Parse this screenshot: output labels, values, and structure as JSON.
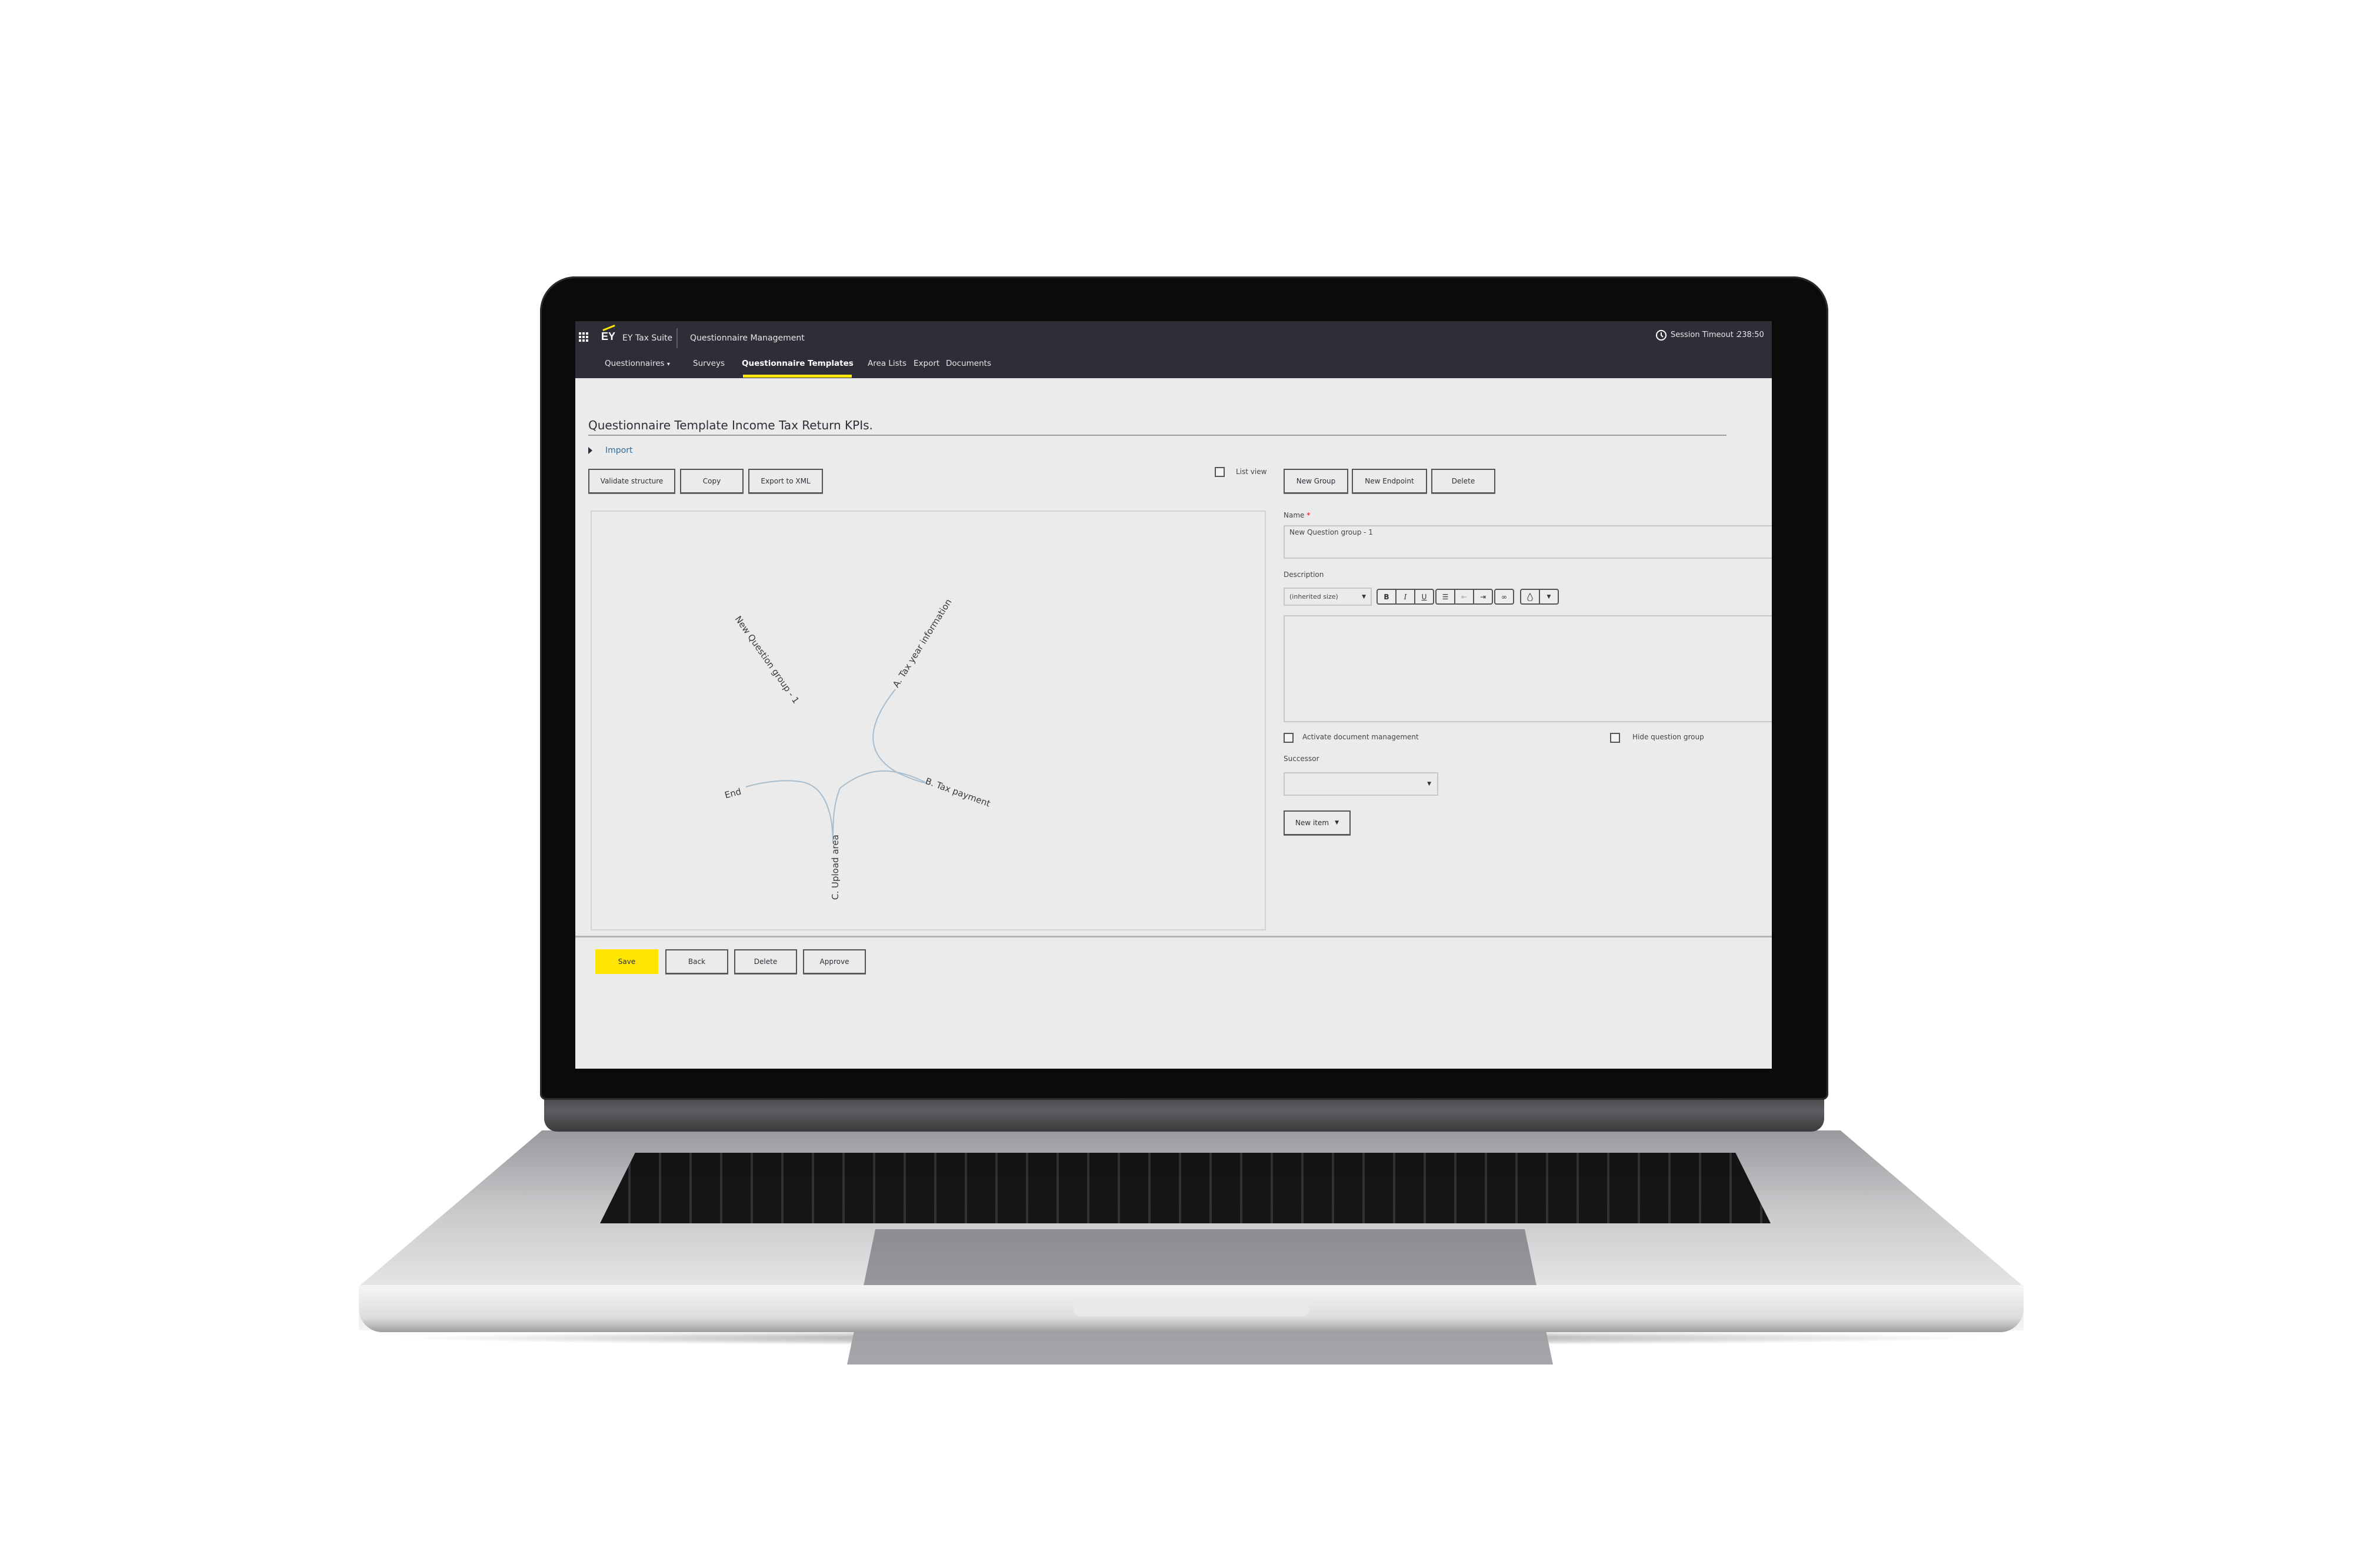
{
  "header": {
    "brand_logo": "EY",
    "suite_name": "EY Tax Suite",
    "module_name": "Questionnaire Management",
    "session_label": "Session Timeout :",
    "session_value": "238:50",
    "icons": {
      "apps": "grid-icon",
      "clock": "clock-icon"
    }
  },
  "nav": {
    "items": [
      {
        "label": "Questionnaires",
        "has_dropdown": true
      },
      {
        "label": "Surveys"
      },
      {
        "label": "Questionnaire Templates",
        "active": true
      },
      {
        "label": "Area Lists"
      },
      {
        "label": "Export"
      },
      {
        "label": "Documents"
      }
    ],
    "dropdown_glyph": "▾"
  },
  "page": {
    "title": "Questionnaire Template Income Tax Return KPIs.",
    "import_label": "Import",
    "toolbar_left": [
      "Validate structure",
      "Copy",
      "Export to XML"
    ],
    "list_view_label": "List view",
    "toolbar_right": [
      "New Group",
      "New Endpoint",
      "Delete"
    ]
  },
  "graph": {
    "nodes": [
      {
        "label": "New Question group - 1"
      },
      {
        "label": "A. Tax year information"
      },
      {
        "label": "B. Tax payment"
      },
      {
        "label": "C. Upload area"
      },
      {
        "label": "End"
      }
    ],
    "edges": [
      [
        "A. Tax year information",
        "B. Tax payment"
      ],
      [
        "B. Tax payment",
        "C. Upload area"
      ],
      [
        "C. Upload area",
        "End"
      ]
    ],
    "edge_color": "#a9bccb"
  },
  "form": {
    "name_label": "Name",
    "required_mark": "*",
    "name_value": "New Question group - 1",
    "description_label": "Description",
    "font_size_select": "(inherited size)",
    "editor_buttons": [
      "B",
      "I",
      "U"
    ],
    "editor_icons": [
      "bullet-list-icon",
      "outdent-icon",
      "indent-icon",
      "link-icon",
      "color-drop-icon",
      "dropdown-caret-icon"
    ],
    "description_value": "",
    "activate_doc_mgmt_label": "Activate document management",
    "activate_doc_mgmt_checked": false,
    "hide_group_label": "Hide question group",
    "hide_group_checked": false,
    "successor_label": "Successor",
    "successor_value": "",
    "new_item_label": "New item"
  },
  "footer_buttons": {
    "save": "Save",
    "back": "Back",
    "delete": "Delete",
    "approve": "Approve"
  },
  "colors": {
    "header_bg": "#2e2e38",
    "accent_yellow": "#ffe600",
    "page_bg": "#ebebeb",
    "link": "#2e6c9c"
  }
}
